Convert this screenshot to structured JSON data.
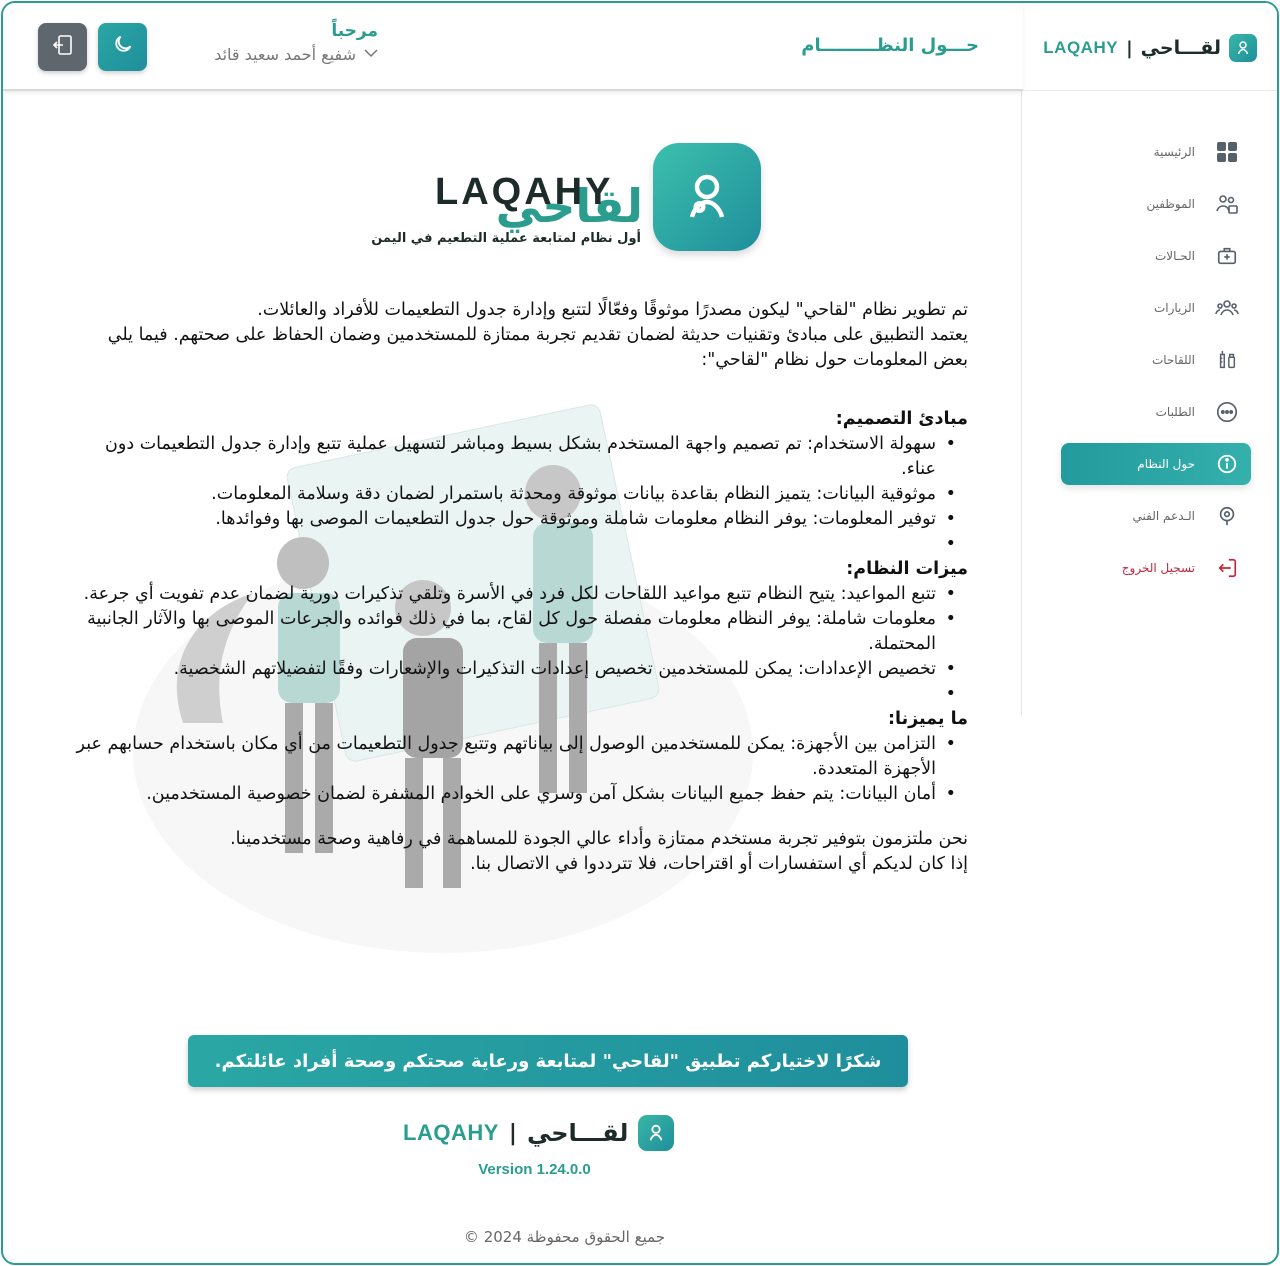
{
  "brand": {
    "ar": "لقـــاحي",
    "sep": "|",
    "en": "LAQAHY"
  },
  "header": {
    "page_title": "حـــول النظـــــــــام",
    "welcome": "مرحباً",
    "user_name": "شفيع أحمد سعيد قائد"
  },
  "sidebar": {
    "items": [
      {
        "label": "الرئيسية",
        "icon": "grid-icon"
      },
      {
        "label": "الموظفين",
        "icon": "employees-icon"
      },
      {
        "label": "الحـالات",
        "icon": "medical-kit-icon"
      },
      {
        "label": "الزيارات",
        "icon": "visits-icon"
      },
      {
        "label": "اللقاحات",
        "icon": "vaccine-icon"
      },
      {
        "label": "الطلبات",
        "icon": "chat-icon"
      },
      {
        "label": "حول النظام",
        "icon": "info-icon"
      },
      {
        "label": "الـدعم الفني",
        "icon": "support-icon"
      },
      {
        "label": "تسجيل الخروج",
        "icon": "logout-icon"
      }
    ]
  },
  "logo": {
    "en": "LAQAHY",
    "ar": "لقاحي",
    "tagline": "أول نظام لمتابعة عملية التطعيم في اليمن"
  },
  "intro": [
    "تم تطوير نظام \"لقاحي\" ليكون مصدرًا موثوقًا وفعّالًا لتتبع وإدارة جدول التطعيمات للأفراد والعائلات.",
    "يعتمد التطبيق على مبادئ وتقنيات حديثة لضمان تقديم تجربة ممتازة للمستخدمين وضمان الحفاظ على صحتهم. فيما يلي بعض المعلومات حول نظام \"لقاحي\":"
  ],
  "sections": [
    {
      "title": "مبادئ التصميم:",
      "items": [
        "سهولة الاستخدام: تم تصميم واجهة المستخدم بشكل بسيط ومباشر لتسهيل عملية تتبع وإدارة جدول التطعيمات دون عناء.",
        "موثوقية البيانات: يتميز النظام بقاعدة بيانات موثوقة ومحدثة باستمرار لضمان دقة وسلامة المعلومات.",
        "توفير المعلومات: يوفر النظام معلومات شاملة وموثوقة حول جدول التطعيمات الموصى بها وفوائدها.",
        ""
      ]
    },
    {
      "title": "ميزات النظام:",
      "items": [
        "تتبع المواعيد: يتيح النظام تتبع مواعيد اللقاحات لكل فرد في الأسرة وتلقي تذكيرات دورية لضمان عدم تفويت أي جرعة.",
        "معلومات شاملة: يوفر النظام معلومات مفصلة حول كل لقاح، بما في ذلك فوائده والجرعات الموصى بها والآثار الجانبية المحتملة.",
        "تخصيص الإعدادات: يمكن للمستخدمين تخصيص إعدادات التذكيرات والإشعارات وفقًا لتفضيلاتهم الشخصية.",
        ""
      ]
    },
    {
      "title": "ما يميزنا:",
      "items": [
        "التزامن بين الأجهزة: يمكن للمستخدمين الوصول إلى بياناتهم وتتبع جدول التطعيمات من أي مكان باستخدام حسابهم عبر الأجهزة المتعددة.",
        "أمان البيانات: يتم حفظ جميع البيانات بشكل آمن وسري على الخوادم المشفرة لضمان خصوصية المستخدمين."
      ]
    }
  ],
  "closing": [
    "نحن ملتزمون بتوفير تجربة مستخدم ممتازة وأداء عالي الجودة للمساهمة في رفاهية وصحة مستخدمينا.",
    "إذا كان لديكم أي استفسارات أو اقتراحات، فلا تترددوا في الاتصال بنا."
  ],
  "cta": "شكرًا لاختياركم تطبيق \"لقاحي\" لمتابعة ورعاية صحتكم وصحة أفراد عائلتكم.",
  "version": "Version 1.24.0.0",
  "copyright": "جميع الحقوق محفوظة 2024 ©",
  "colors": {
    "accent": "#2a9d8f",
    "logout": "#c2273e",
    "exit_button": "#5e666e"
  }
}
